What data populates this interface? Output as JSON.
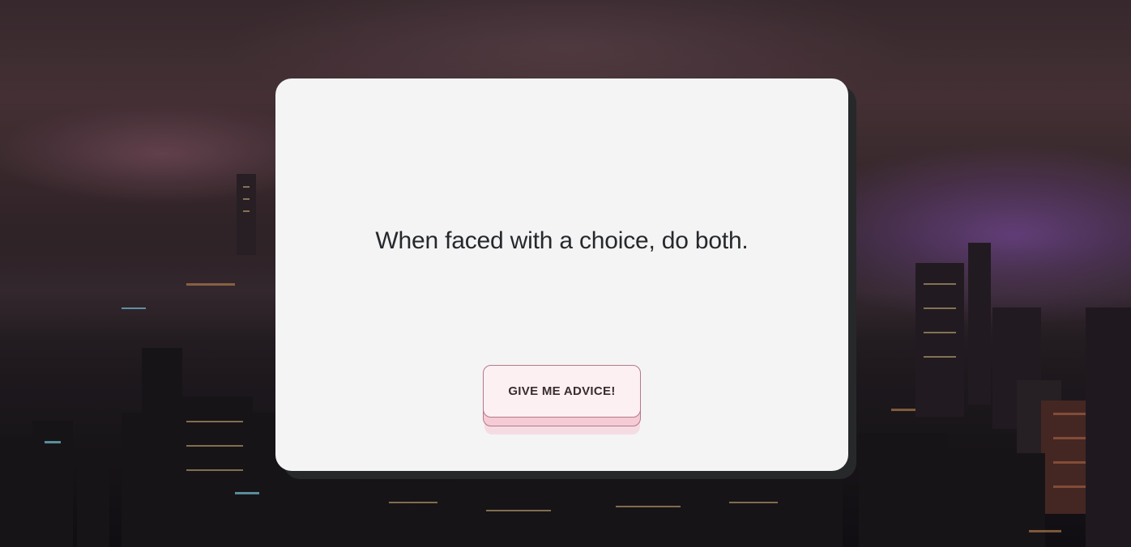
{
  "card": {
    "advice": "When faced with a choice, do both.",
    "button_label": "GIVE ME ADVICE!"
  },
  "colors": {
    "card_background": "#f4f4f5",
    "card_shadow": "#262829",
    "advice_text": "#26292c",
    "button_face": "#fdf0f2",
    "button_base": "#f5cbd6",
    "button_border": "#b5788b"
  }
}
